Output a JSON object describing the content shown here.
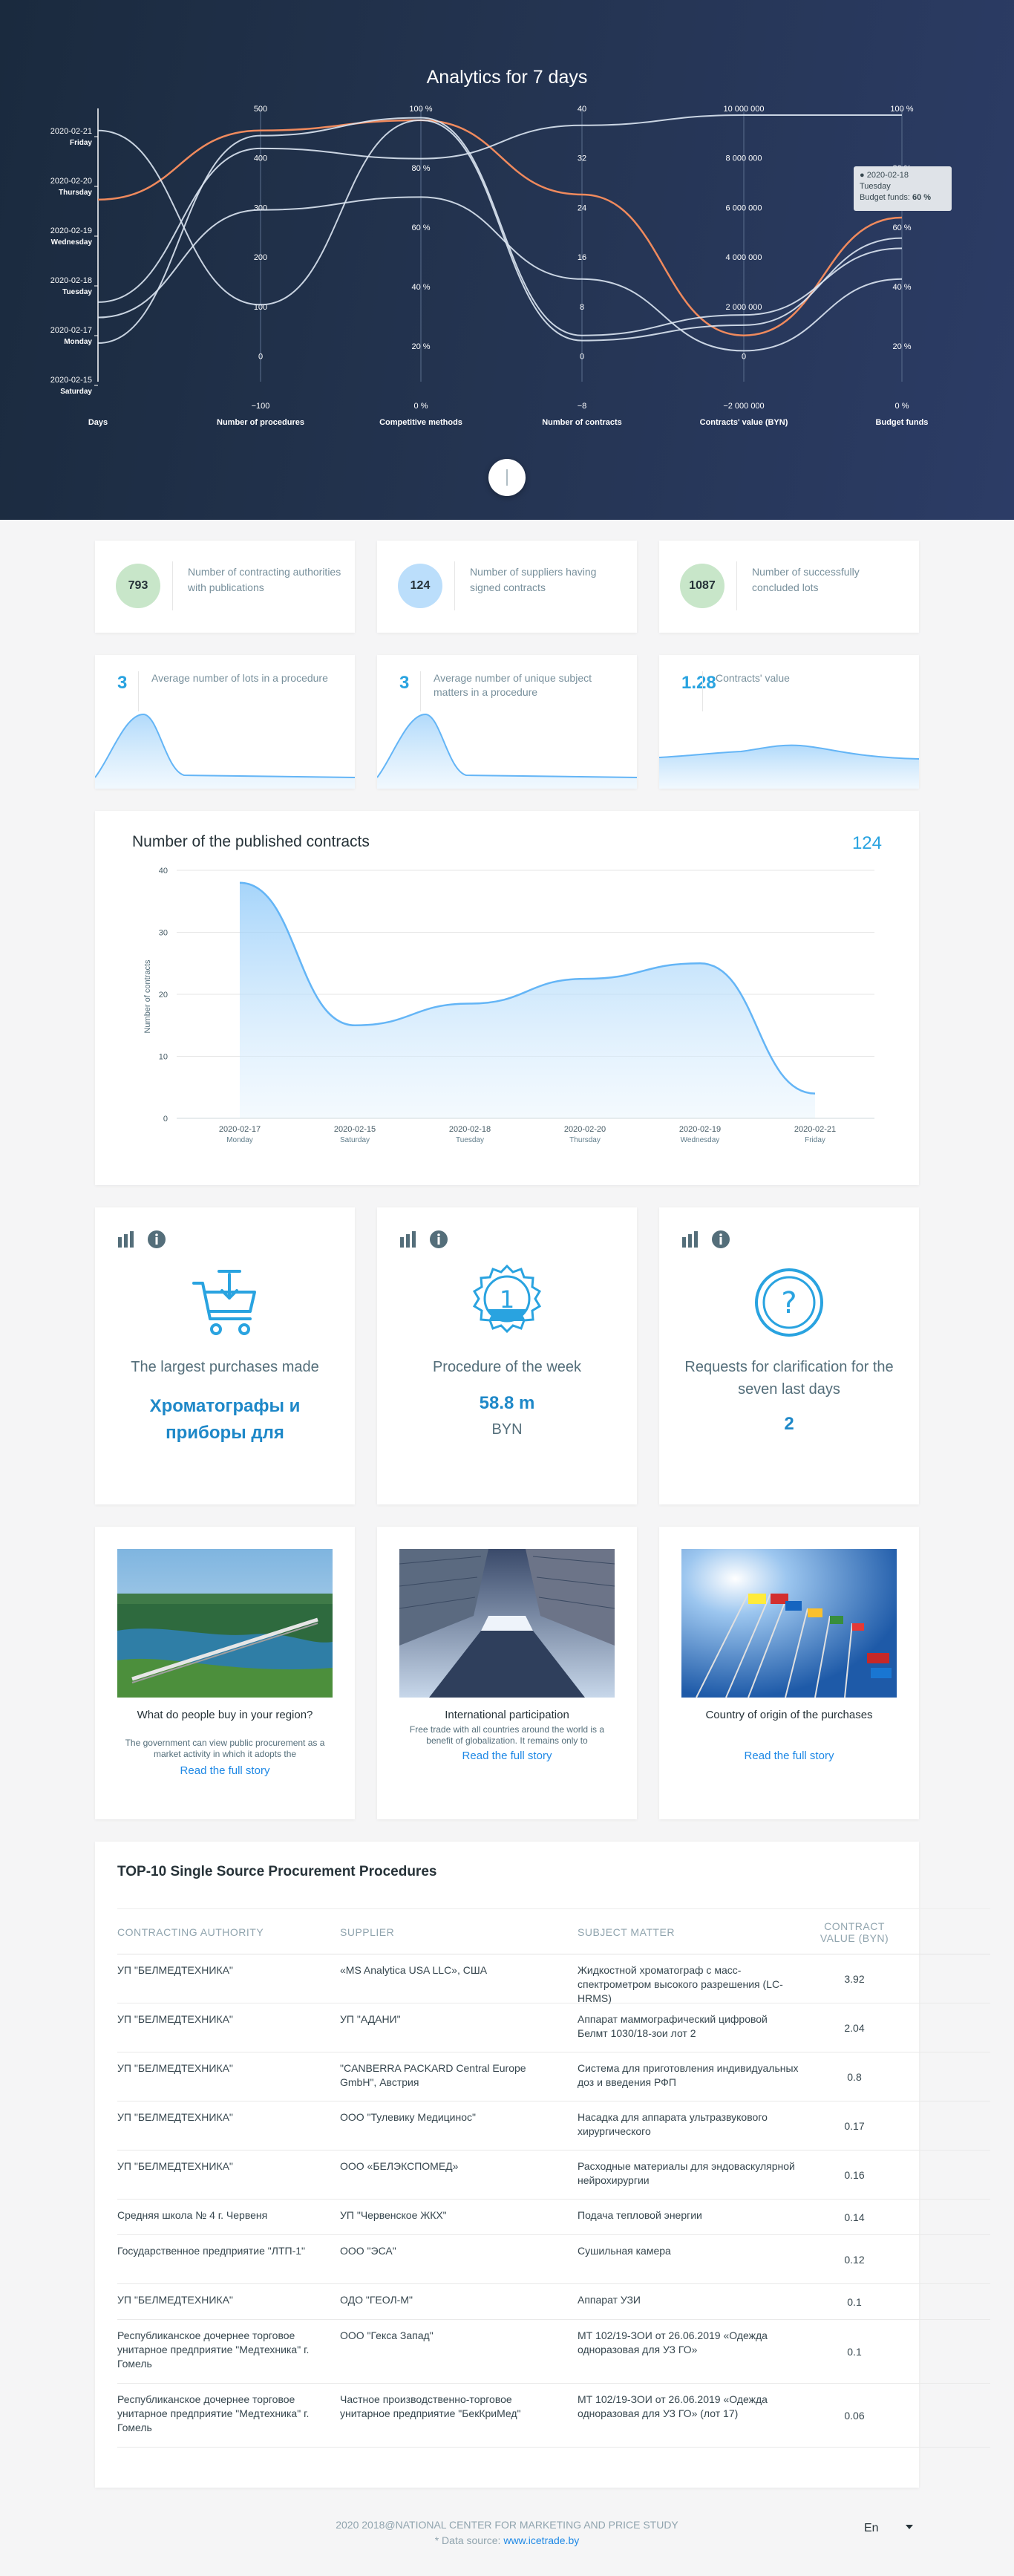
{
  "hero": {
    "title": "Analytics for 7 days",
    "tooltip": {
      "date": "2020-02-18",
      "day": "Tuesday",
      "label": "Budget funds:",
      "value": "60 %"
    }
  },
  "chart_data": [
    {
      "type": "line",
      "title": "Analytics for 7 days",
      "axes": [
        {
          "name": "Days",
          "ticks": [
            {
              "date": "2020-02-21",
              "day": "Friday"
            },
            {
              "date": "2020-02-20",
              "day": "Thursday"
            },
            {
              "date": "2020-02-19",
              "day": "Wednesday"
            },
            {
              "date": "2020-02-18",
              "day": "Tuesday"
            },
            {
              "date": "2020-02-17",
              "day": "Monday"
            },
            {
              "date": "2020-02-15",
              "day": "Saturday"
            }
          ]
        },
        {
          "name": "Number of procedures",
          "ticks": [
            "500",
            "400",
            "300",
            "200",
            "100",
            "0",
            "−100"
          ]
        },
        {
          "name": "Competitive methods",
          "ticks": [
            "100 %",
            "80 %",
            "60 %",
            "40 %",
            "20 %",
            "0 %"
          ]
        },
        {
          "name": "Number of contracts",
          "ticks": [
            "40",
            "32",
            "24",
            "16",
            "8",
            "0",
            "−8"
          ]
        },
        {
          "name": "Contracts' value (BYN)",
          "ticks": [
            "10 000 000",
            "8 000 000",
            "6 000 000",
            "4 000 000",
            "2 000 000",
            "0",
            "−2 000 000"
          ]
        },
        {
          "name": "Budget funds",
          "ticks": [
            "100 %",
            "80 %",
            "60 %",
            "40 %",
            "20 %",
            "0 %"
          ]
        }
      ],
      "series": [
        {
          "highlight": true,
          "values": [
            0.33,
            0.06,
            0.02,
            0.31,
            0.86,
            0.4
          ]
        },
        {
          "highlight": false,
          "values": [
            0.06,
            0.74,
            0.02,
            0.88,
            0.82,
            0.48
          ]
        },
        {
          "highlight": false,
          "values": [
            0.89,
            0.08,
            0.01,
            0.86,
            0.78,
            0.52
          ]
        },
        {
          "highlight": false,
          "values": [
            0.79,
            0.37,
            0.32,
            0.64,
            0.92,
            0.64
          ]
        },
        {
          "highlight": false,
          "values": [
            0.73,
            0.13,
            0.17,
            0.04,
            0.0,
            0.0
          ]
        }
      ]
    },
    {
      "type": "area",
      "title": "Number of the published contracts",
      "ylabel": "Number of contracts",
      "categories": [
        {
          "date": "2020-02-17",
          "day": "Monday"
        },
        {
          "date": "2020-02-15",
          "day": "Saturday"
        },
        {
          "date": "2020-02-18",
          "day": "Tuesday"
        },
        {
          "date": "2020-02-20",
          "day": "Thursday"
        },
        {
          "date": "2020-02-19",
          "day": "Wednesday"
        },
        {
          "date": "2020-02-21",
          "day": "Friday"
        }
      ],
      "values": [
        38,
        15,
        18.5,
        22.5,
        25,
        4
      ],
      "ylim": [
        0,
        40
      ],
      "yticks": [
        0,
        10,
        20,
        30,
        40
      ],
      "grid": true
    }
  ],
  "stats": [
    {
      "value": "793",
      "label": "Number of contracting authorities with publications",
      "color": "#c8e6c9"
    },
    {
      "value": "124",
      "label": "Number of suppliers having signed contracts",
      "color": "#bbdefb"
    },
    {
      "value": "1087",
      "label": "Number of successfully concluded lots",
      "color": "#c8e6c9"
    }
  ],
  "minis": [
    {
      "value": "3",
      "label": "Average number of lots in a procedure"
    },
    {
      "value": "3",
      "label": "Average number of unique subject matters in a procedure"
    },
    {
      "value": "1.28",
      "label": "Contracts' value"
    }
  ],
  "contracts_chart": {
    "title": "Number of the published contracts",
    "count": "124"
  },
  "features": [
    {
      "title": "The largest purchases made",
      "big": "Хроматографы и приборы для",
      "sub": "",
      "icon": "cart-icon"
    },
    {
      "title": "Procedure of the week",
      "big": "58.8 m",
      "sub": "BYN",
      "icon": "badge-icon"
    },
    {
      "title": "Requests for clarification for the seven last days",
      "big": "2",
      "sub": "",
      "icon": "question-icon"
    }
  ],
  "stories": [
    {
      "title": "What do people buy in your region?",
      "text": "The government can view public procurement as a market activity in which it adopts the",
      "link": "Read the full story"
    },
    {
      "title": "International participation",
      "text": "Free trade with all countries around the world is a benefit of globalization. It remains only to",
      "link": "Read the full story"
    },
    {
      "title": "Country of origin of the purchases",
      "text": "",
      "link": "Read the full story"
    }
  ],
  "table": {
    "title": "TOP-10 Single Source Procurement Procedures",
    "headers": [
      "CONTRACTING AUTHORITY",
      "SUPPLIER",
      "SUBJECT MATTER",
      "CONTRACT VALUE (BYN)"
    ],
    "rows": [
      [
        "УП \"БЕЛМЕДТЕХНИКА\"",
        "«MS Analytica USA LLC», США",
        "Жидкостной хроматограф с масс-спектрометром высокого разрешения (LC-HRMS)",
        "3.92"
      ],
      [
        "УП \"БЕЛМЕДТЕХНИКА\"",
        "УП \"АДАНИ\"",
        "Аппарат маммографический цифровой Белмт 1030/18-зои лот 2",
        "2.04"
      ],
      [
        "УП \"БЕЛМЕДТЕХНИКА\"",
        "\"CANBERRA PACKARD Central Europe GmbH\", Австрия",
        "Система для приготовления индивидуальных доз и введения РФП",
        "0.8"
      ],
      [
        "УП \"БЕЛМЕДТЕХНИКА\"",
        "ООО \"Тулевику Медицинос\"",
        "Насадка для аппарата ультразвукового хирургического",
        "0.17"
      ],
      [
        "УП \"БЕЛМЕДТЕХНИКА\"",
        "ООО «БЕЛЭКСПОМЕД»",
        "Расходные материалы для эндоваскулярной нейрохирургии",
        "0.16"
      ],
      [
        "Средняя школа № 4 г. Червеня",
        "УП \"Червенское ЖКХ\"",
        "Подача тепловой энергии",
        "0.14"
      ],
      [
        "Государственное предприятие \"ЛТП-1\"",
        "ООО \"ЭСА\"",
        "Сушильная камера",
        "0.12"
      ],
      [
        "УП \"БЕЛМЕДТЕХНИКА\"",
        "ОДО \"ГЕОЛ-М\"",
        "Аппарат УЗИ",
        "0.1"
      ],
      [
        "Республиканское дочернее торговое унитарное предприятие \"Медтехника\" г. Гомель",
        "ООО \"Гекса Запад\"",
        "МТ 102/19-ЗОИ от 26.06.2019 «Одежда одноразовая для УЗ ГО»",
        "0.1"
      ],
      [
        "Республиканское дочернее торговое унитарное предприятие \"Медтехника\" г. Гомель",
        "Частное производственно-торговое унитарное предприятие \"БекКриМед\"",
        "МТ 102/19-ЗОИ от 26.06.2019 «Одежда одноразовая для УЗ ГО» (лот 17)",
        "0.06"
      ]
    ]
  },
  "footer": {
    "copyright": "2020 2018@NATIONAL CENTER FOR MARKETING AND PRICE STUDY",
    "source_prefix": "* Data source:",
    "source_link": "www.icetrade.by",
    "language": "En"
  }
}
